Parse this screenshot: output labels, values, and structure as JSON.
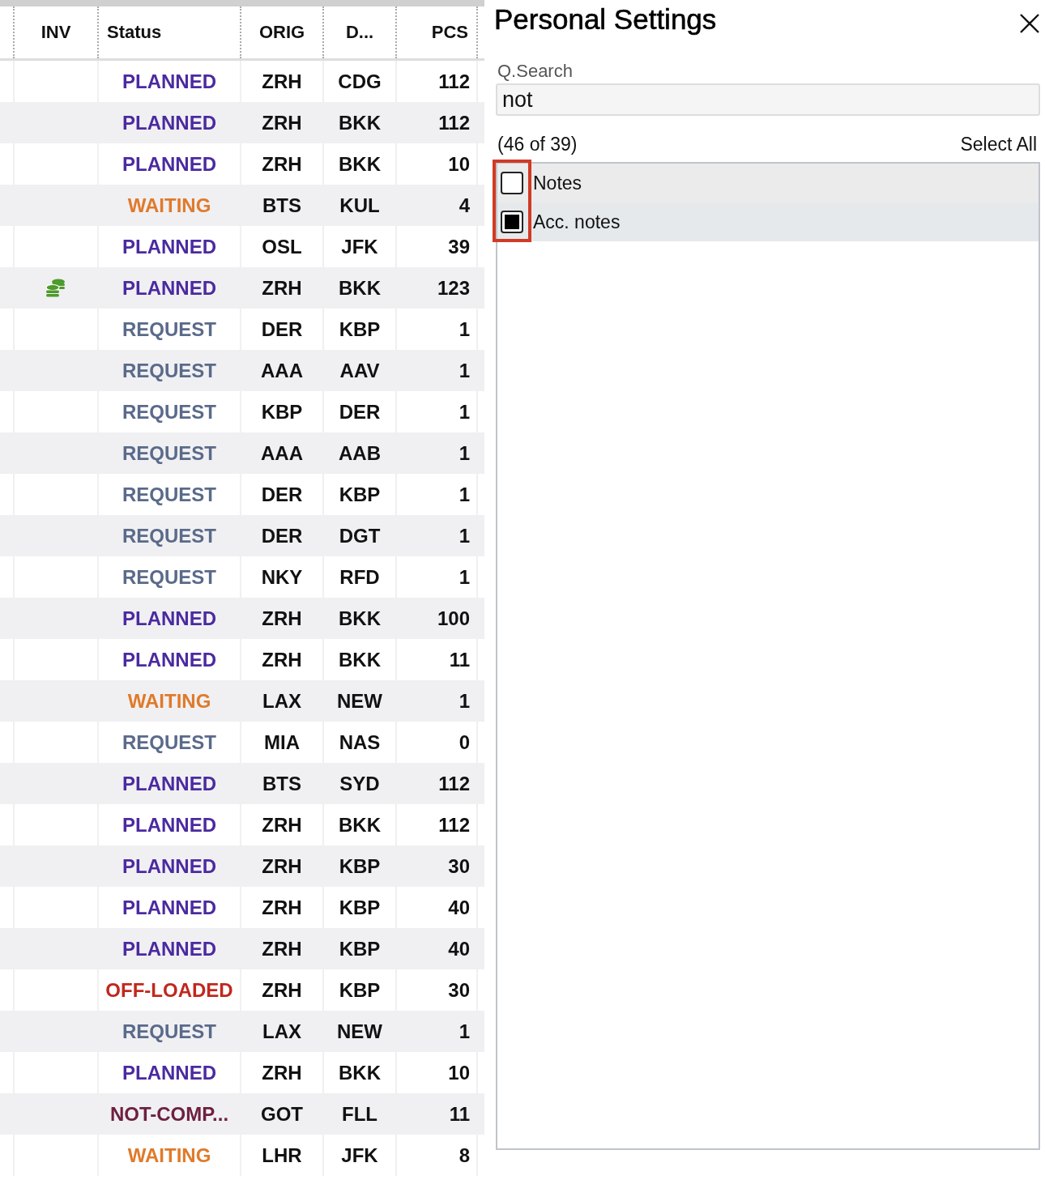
{
  "table": {
    "columns": [
      "INV",
      "Status",
      "ORIG",
      "D...",
      "PCS"
    ],
    "rows": [
      {
        "coins": false,
        "status": "PLANNED",
        "color": "#4b2aa0",
        "orig": "ZRH",
        "dest": "CDG",
        "pcs": "112"
      },
      {
        "coins": false,
        "status": "PLANNED",
        "color": "#4b2aa0",
        "orig": "ZRH",
        "dest": "BKK",
        "pcs": "112"
      },
      {
        "coins": false,
        "status": "PLANNED",
        "color": "#4b2aa0",
        "orig": "ZRH",
        "dest": "BKK",
        "pcs": "10"
      },
      {
        "coins": false,
        "status": "WAITING",
        "color": "#e07a2a",
        "orig": "BTS",
        "dest": "KUL",
        "pcs": "4"
      },
      {
        "coins": false,
        "status": "PLANNED",
        "color": "#4b2aa0",
        "orig": "OSL",
        "dest": "JFK",
        "pcs": "39"
      },
      {
        "coins": true,
        "status": "PLANNED",
        "color": "#4b2aa0",
        "orig": "ZRH",
        "dest": "BKK",
        "pcs": "123"
      },
      {
        "coins": false,
        "status": "REQUEST",
        "color": "#5a6a8a",
        "orig": "DER",
        "dest": "KBP",
        "pcs": "1"
      },
      {
        "coins": false,
        "status": "REQUEST",
        "color": "#5a6a8a",
        "orig": "AAA",
        "dest": "AAV",
        "pcs": "1"
      },
      {
        "coins": false,
        "status": "REQUEST",
        "color": "#5a6a8a",
        "orig": "KBP",
        "dest": "DER",
        "pcs": "1"
      },
      {
        "coins": false,
        "status": "REQUEST",
        "color": "#5a6a8a",
        "orig": "AAA",
        "dest": "AAB",
        "pcs": "1"
      },
      {
        "coins": false,
        "status": "REQUEST",
        "color": "#5a6a8a",
        "orig": "DER",
        "dest": "KBP",
        "pcs": "1"
      },
      {
        "coins": false,
        "status": "REQUEST",
        "color": "#5a6a8a",
        "orig": "DER",
        "dest": "DGT",
        "pcs": "1"
      },
      {
        "coins": false,
        "status": "REQUEST",
        "color": "#5a6a8a",
        "orig": "NKY",
        "dest": "RFD",
        "pcs": "1"
      },
      {
        "coins": false,
        "status": "PLANNED",
        "color": "#4b2aa0",
        "orig": "ZRH",
        "dest": "BKK",
        "pcs": "100"
      },
      {
        "coins": false,
        "status": "PLANNED",
        "color": "#4b2aa0",
        "orig": "ZRH",
        "dest": "BKK",
        "pcs": "11"
      },
      {
        "coins": false,
        "status": "WAITING",
        "color": "#e07a2a",
        "orig": "LAX",
        "dest": "NEW",
        "pcs": "1"
      },
      {
        "coins": false,
        "status": "REQUEST",
        "color": "#5a6a8a",
        "orig": "MIA",
        "dest": "NAS",
        "pcs": "0"
      },
      {
        "coins": false,
        "status": "PLANNED",
        "color": "#4b2aa0",
        "orig": "BTS",
        "dest": "SYD",
        "pcs": "112"
      },
      {
        "coins": false,
        "status": "PLANNED",
        "color": "#4b2aa0",
        "orig": "ZRH",
        "dest": "BKK",
        "pcs": "112"
      },
      {
        "coins": false,
        "status": "PLANNED",
        "color": "#4b2aa0",
        "orig": "ZRH",
        "dest": "KBP",
        "pcs": "30"
      },
      {
        "coins": false,
        "status": "PLANNED",
        "color": "#4b2aa0",
        "orig": "ZRH",
        "dest": "KBP",
        "pcs": "40"
      },
      {
        "coins": false,
        "status": "PLANNED",
        "color": "#4b2aa0",
        "orig": "ZRH",
        "dest": "KBP",
        "pcs": "40"
      },
      {
        "coins": false,
        "status": "OFF-LOADED",
        "color": "#c0281e",
        "orig": "ZRH",
        "dest": "KBP",
        "pcs": "30"
      },
      {
        "coins": false,
        "status": "REQUEST",
        "color": "#5a6a8a",
        "orig": "LAX",
        "dest": "NEW",
        "pcs": "1"
      },
      {
        "coins": false,
        "status": "PLANNED",
        "color": "#4b2aa0",
        "orig": "ZRH",
        "dest": "BKK",
        "pcs": "10"
      },
      {
        "coins": false,
        "status": "NOT-COMP...",
        "color": "#6e2040",
        "orig": "GOT",
        "dest": "FLL",
        "pcs": "11"
      },
      {
        "coins": false,
        "status": "WAITING",
        "color": "#e07a2a",
        "orig": "LHR",
        "dest": "JFK",
        "pcs": "8"
      }
    ]
  },
  "panel": {
    "title": "Personal Settings",
    "search": {
      "label": "Q.Search",
      "value": "not"
    },
    "count": "(46 of 39)",
    "select_all": "Select All",
    "highlight_checkboxes": true,
    "items": [
      {
        "label": "Notes",
        "checked": false
      },
      {
        "label": "Acc. notes",
        "checked": true
      }
    ]
  }
}
